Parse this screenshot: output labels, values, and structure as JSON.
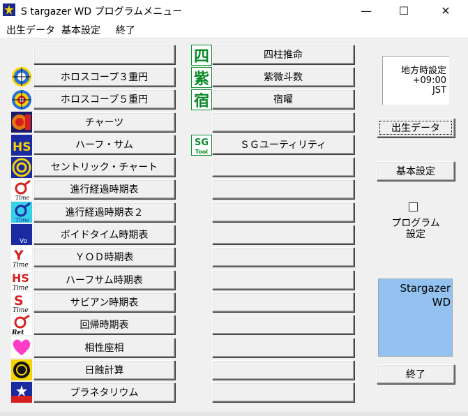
{
  "window": {
    "title": "S targazer WD プログラムメニュー"
  },
  "titlebar": {
    "minimize": "—",
    "maximize": "☐",
    "close": "✕"
  },
  "menu": [
    "出生データ",
    "基本設定",
    "終了"
  ],
  "left_buttons": [
    {
      "label": "",
      "icon": "none"
    },
    {
      "label": "ホロスコープ３重円",
      "icon": "horoscope-3-icon"
    },
    {
      "label": "ホロスコープ５重円",
      "icon": "horoscope-5-icon"
    },
    {
      "label": "チャーツ",
      "icon": "charts-icon"
    },
    {
      "label": "ハーフ・サム",
      "icon": "hs-icon"
    },
    {
      "label": "セントリック・チャート",
      "icon": "centric-icon"
    },
    {
      "label": "進行経過時期表",
      "icon": "transit-time-icon"
    },
    {
      "label": "進行経過時期表２",
      "icon": "transit-time-2-icon"
    },
    {
      "label": "ボイドタイム時期表",
      "icon": "void-time-icon"
    },
    {
      "label": "ＹＯＤ時期表",
      "icon": "yod-time-icon"
    },
    {
      "label": "ハーフサム時期表",
      "icon": "hs-time-icon"
    },
    {
      "label": "サビアン時期表",
      "icon": "sabian-time-icon"
    },
    {
      "label": "回帰時期表",
      "icon": "return-time-icon"
    },
    {
      "label": "相性座相",
      "icon": "heart-icon"
    },
    {
      "label": "日蝕計算",
      "icon": "eclipse-icon"
    },
    {
      "label": "プラネタリウム",
      "icon": "planetarium-icon"
    }
  ],
  "middle_buttons": [
    {
      "label": "四柱推命",
      "icon": "kanji-shi-icon",
      "glyph": "四"
    },
    {
      "label": "紫微斗数",
      "icon": "kanji-shi-murasaki-icon",
      "glyph": "紫"
    },
    {
      "label": "宿曜",
      "icon": "kanji-shuku-icon",
      "glyph": "宿"
    },
    {
      "label": "",
      "icon": "none",
      "glyph": ""
    },
    {
      "label": "ＳＧユーティリティ",
      "icon": "sg-tool-icon",
      "glyph": ""
    },
    {
      "label": "",
      "icon": "none",
      "glyph": ""
    },
    {
      "label": "",
      "icon": "none",
      "glyph": ""
    },
    {
      "label": "",
      "icon": "none",
      "glyph": ""
    },
    {
      "label": "",
      "icon": "none",
      "glyph": ""
    },
    {
      "label": "",
      "icon": "none",
      "glyph": ""
    },
    {
      "label": "",
      "icon": "none",
      "glyph": ""
    },
    {
      "label": "",
      "icon": "none",
      "glyph": ""
    },
    {
      "label": "",
      "icon": "none",
      "glyph": ""
    },
    {
      "label": "",
      "icon": "none",
      "glyph": ""
    },
    {
      "label": "",
      "icon": "none",
      "glyph": ""
    },
    {
      "label": "",
      "icon": "none",
      "glyph": ""
    }
  ],
  "right_panel": {
    "local_time_title": "地方時設定",
    "timezone_offset": "+09:00",
    "timezone_name": "JST",
    "birth_data_button": "出生データ",
    "basic_settings_button": "基本設定",
    "program_settings_label": "プログラム\n設定",
    "program_settings_checked": false,
    "brand_line1": "Stargazer",
    "brand_line2": "WD",
    "exit_button": "終了"
  },
  "sg_icon_text": {
    "top": "SG",
    "bottom": "Tool"
  },
  "colors": {
    "green_kanji": "#0a8a2a",
    "blue_panel": "#94c2f0",
    "window_bg": "#f0f0f0"
  }
}
